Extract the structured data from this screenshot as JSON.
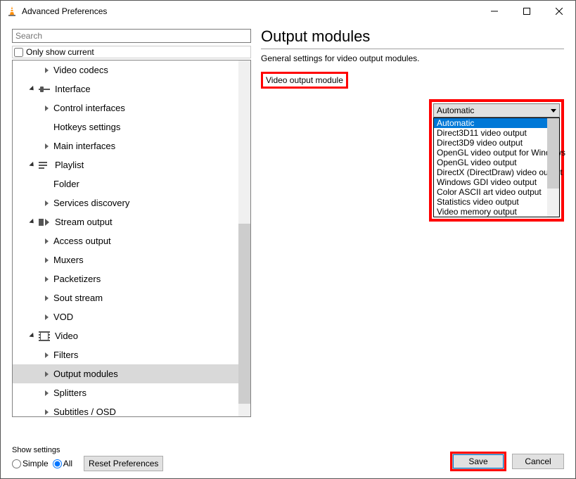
{
  "window": {
    "title": "Advanced Preferences",
    "minimize": "Minimize",
    "maximize": "Maximize",
    "close": "Close"
  },
  "search": {
    "placeholder": "Search"
  },
  "only_current_label": "Only show current",
  "tree": {
    "video_codecs": "Video codecs",
    "interface": "Interface",
    "control_interfaces": "Control interfaces",
    "hotkeys_settings": "Hotkeys settings",
    "main_interfaces": "Main interfaces",
    "playlist": "Playlist",
    "folder": "Folder",
    "services_discovery": "Services discovery",
    "stream_output": "Stream output",
    "access_output": "Access output",
    "muxers": "Muxers",
    "packetizers": "Packetizers",
    "sout_stream": "Sout stream",
    "vod": "VOD",
    "video": "Video",
    "filters": "Filters",
    "output_modules": "Output modules",
    "splitters": "Splitters",
    "subtitles_osd": "Subtitles / OSD"
  },
  "panel": {
    "title": "Output modules",
    "desc": "General settings for video output modules.",
    "field_label": "Video output module",
    "selected": "Automatic",
    "options": {
      "o0": "Automatic",
      "o1": "Direct3D11 video output",
      "o2": "Direct3D9 video output",
      "o3": "OpenGL video output for Windows",
      "o4": "OpenGL video output",
      "o5": "DirectX (DirectDraw) video output",
      "o6": "Windows GDI video output",
      "o7": "Color ASCII art video output",
      "o8": "Statistics video output",
      "o9": "Video memory output"
    }
  },
  "bottom": {
    "show_settings": "Show settings",
    "simple": "Simple",
    "all": "All",
    "reset": "Reset Preferences",
    "save": "Save",
    "cancel": "Cancel"
  }
}
